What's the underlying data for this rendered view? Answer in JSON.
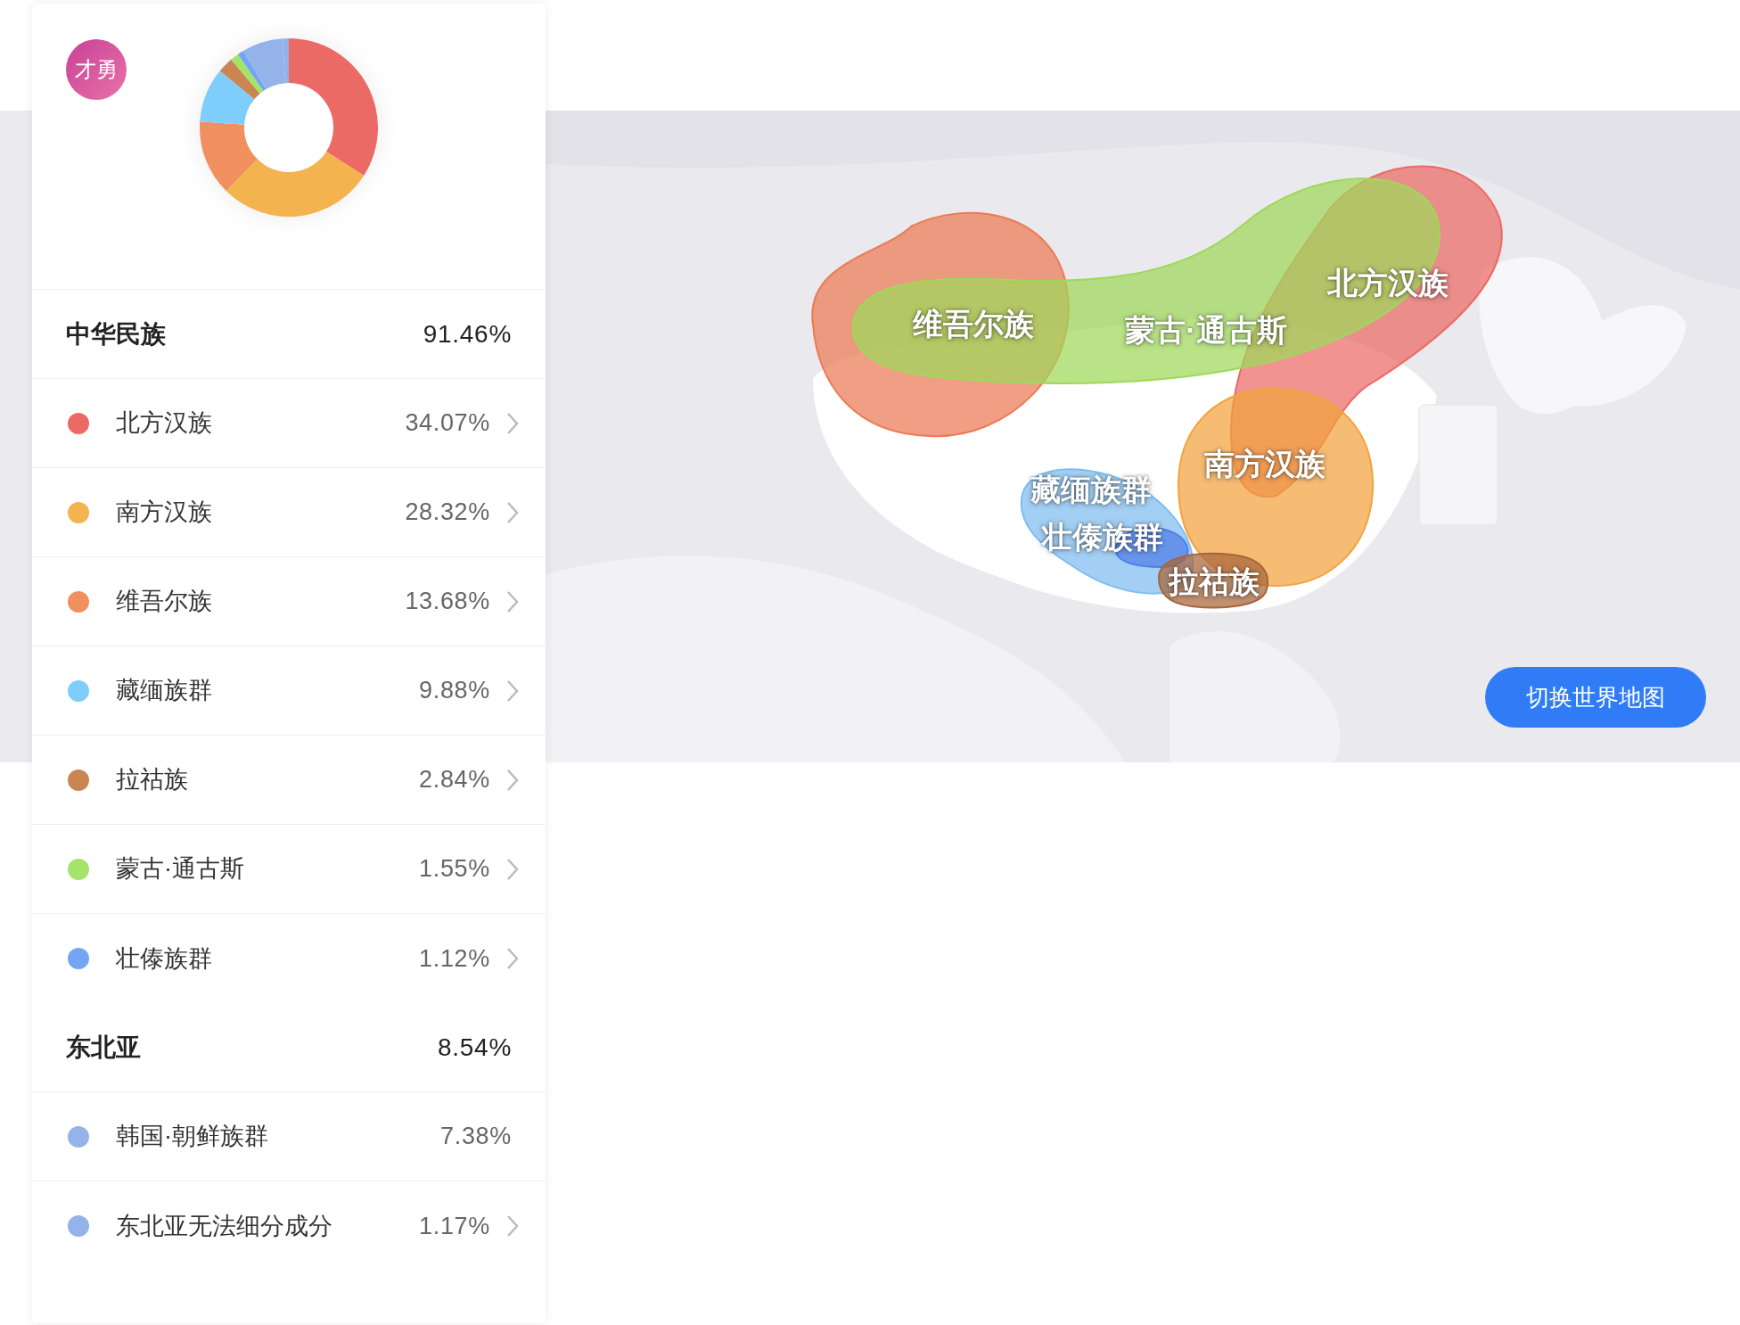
{
  "avatar": {
    "label": "才勇"
  },
  "summary": {
    "chart_data": {
      "type": "donut",
      "values": [
        34.07,
        28.32,
        13.68,
        9.88,
        2.84,
        1.55,
        1.12,
        7.38,
        1.17
      ]
    }
  },
  "groups": [
    {
      "name": "中华民族",
      "value": "91.46%",
      "items": [
        {
          "name": "北方汉族",
          "value": "34.07%",
          "color": "#ec6a65",
          "expandable": true
        },
        {
          "name": "南方汉族",
          "value": "28.32%",
          "color": "#f3b34f",
          "expandable": true
        },
        {
          "name": "维吾尔族",
          "value": "13.68%",
          "color": "#f0905f",
          "expandable": true
        },
        {
          "name": "藏缅族群",
          "value": "9.88%",
          "color": "#7fcdfb",
          "expandable": true
        },
        {
          "name": "拉祜族",
          "value": "2.84%",
          "color": "#c98653",
          "expandable": true
        },
        {
          "name": "蒙古·通古斯",
          "value": "1.55%",
          "color": "#a6e36a",
          "expandable": true
        },
        {
          "name": "壮傣族群",
          "value": "1.12%",
          "color": "#75a4f4",
          "expandable": true
        }
      ]
    },
    {
      "name": "东北亚",
      "value": "8.54%",
      "items": [
        {
          "name": "韩国·朝鲜族群",
          "value": "7.38%",
          "color": "#93b3ea",
          "expandable": false
        },
        {
          "name": "东北亚无法细分成分",
          "value": "1.17%",
          "color": "#93b3ea",
          "expandable": true
        }
      ]
    }
  ],
  "map": {
    "regions": [
      {
        "label": "维吾尔族",
        "color": "#ec7a55"
      },
      {
        "label": "北方汉族",
        "color": "#ec6a65"
      },
      {
        "label": "蒙古·通古斯",
        "color": "#9fd85a"
      },
      {
        "label": "南方汉族",
        "color": "#f3a23f"
      },
      {
        "label": "藏缅族群",
        "color": "#7fbdf0"
      },
      {
        "label": "壮傣族群",
        "color": "#4f7ee8"
      },
      {
        "label": "拉祜族",
        "color": "#a8653a"
      }
    ],
    "switch_button": "切换世界地图"
  }
}
